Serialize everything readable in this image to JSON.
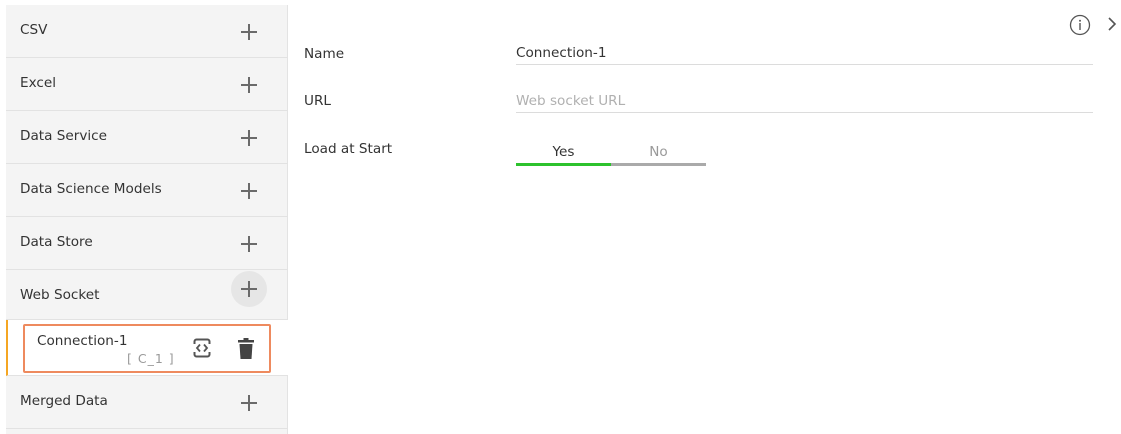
{
  "sidebar": {
    "items": [
      {
        "label": "CSV"
      },
      {
        "label": "Excel"
      },
      {
        "label": "Data Service"
      },
      {
        "label": "Data Science Models"
      },
      {
        "label": "Data Store"
      },
      {
        "label": "Web Socket"
      },
      {
        "label": "Merged Data"
      }
    ],
    "connection": {
      "label": "Connection-1",
      "id": "[ C_1 ]"
    },
    "icons": {
      "add": "plus-icon",
      "code": "code-icon",
      "delete": "trash-icon"
    },
    "accent_color": "#f5a623",
    "highlight_color": "#ee8a5e"
  },
  "form": {
    "name_label": "Name",
    "name_value": "Connection-1",
    "url_label": "URL",
    "url_placeholder": "Web socket URL",
    "load_label": "Load at Start",
    "toggle_yes": "Yes",
    "toggle_no": "No",
    "toggle_selected": "Yes",
    "toggle_active_color": "#2dc22d"
  },
  "header": {
    "icons": [
      "info-icon",
      "chevron-right-icon"
    ]
  }
}
